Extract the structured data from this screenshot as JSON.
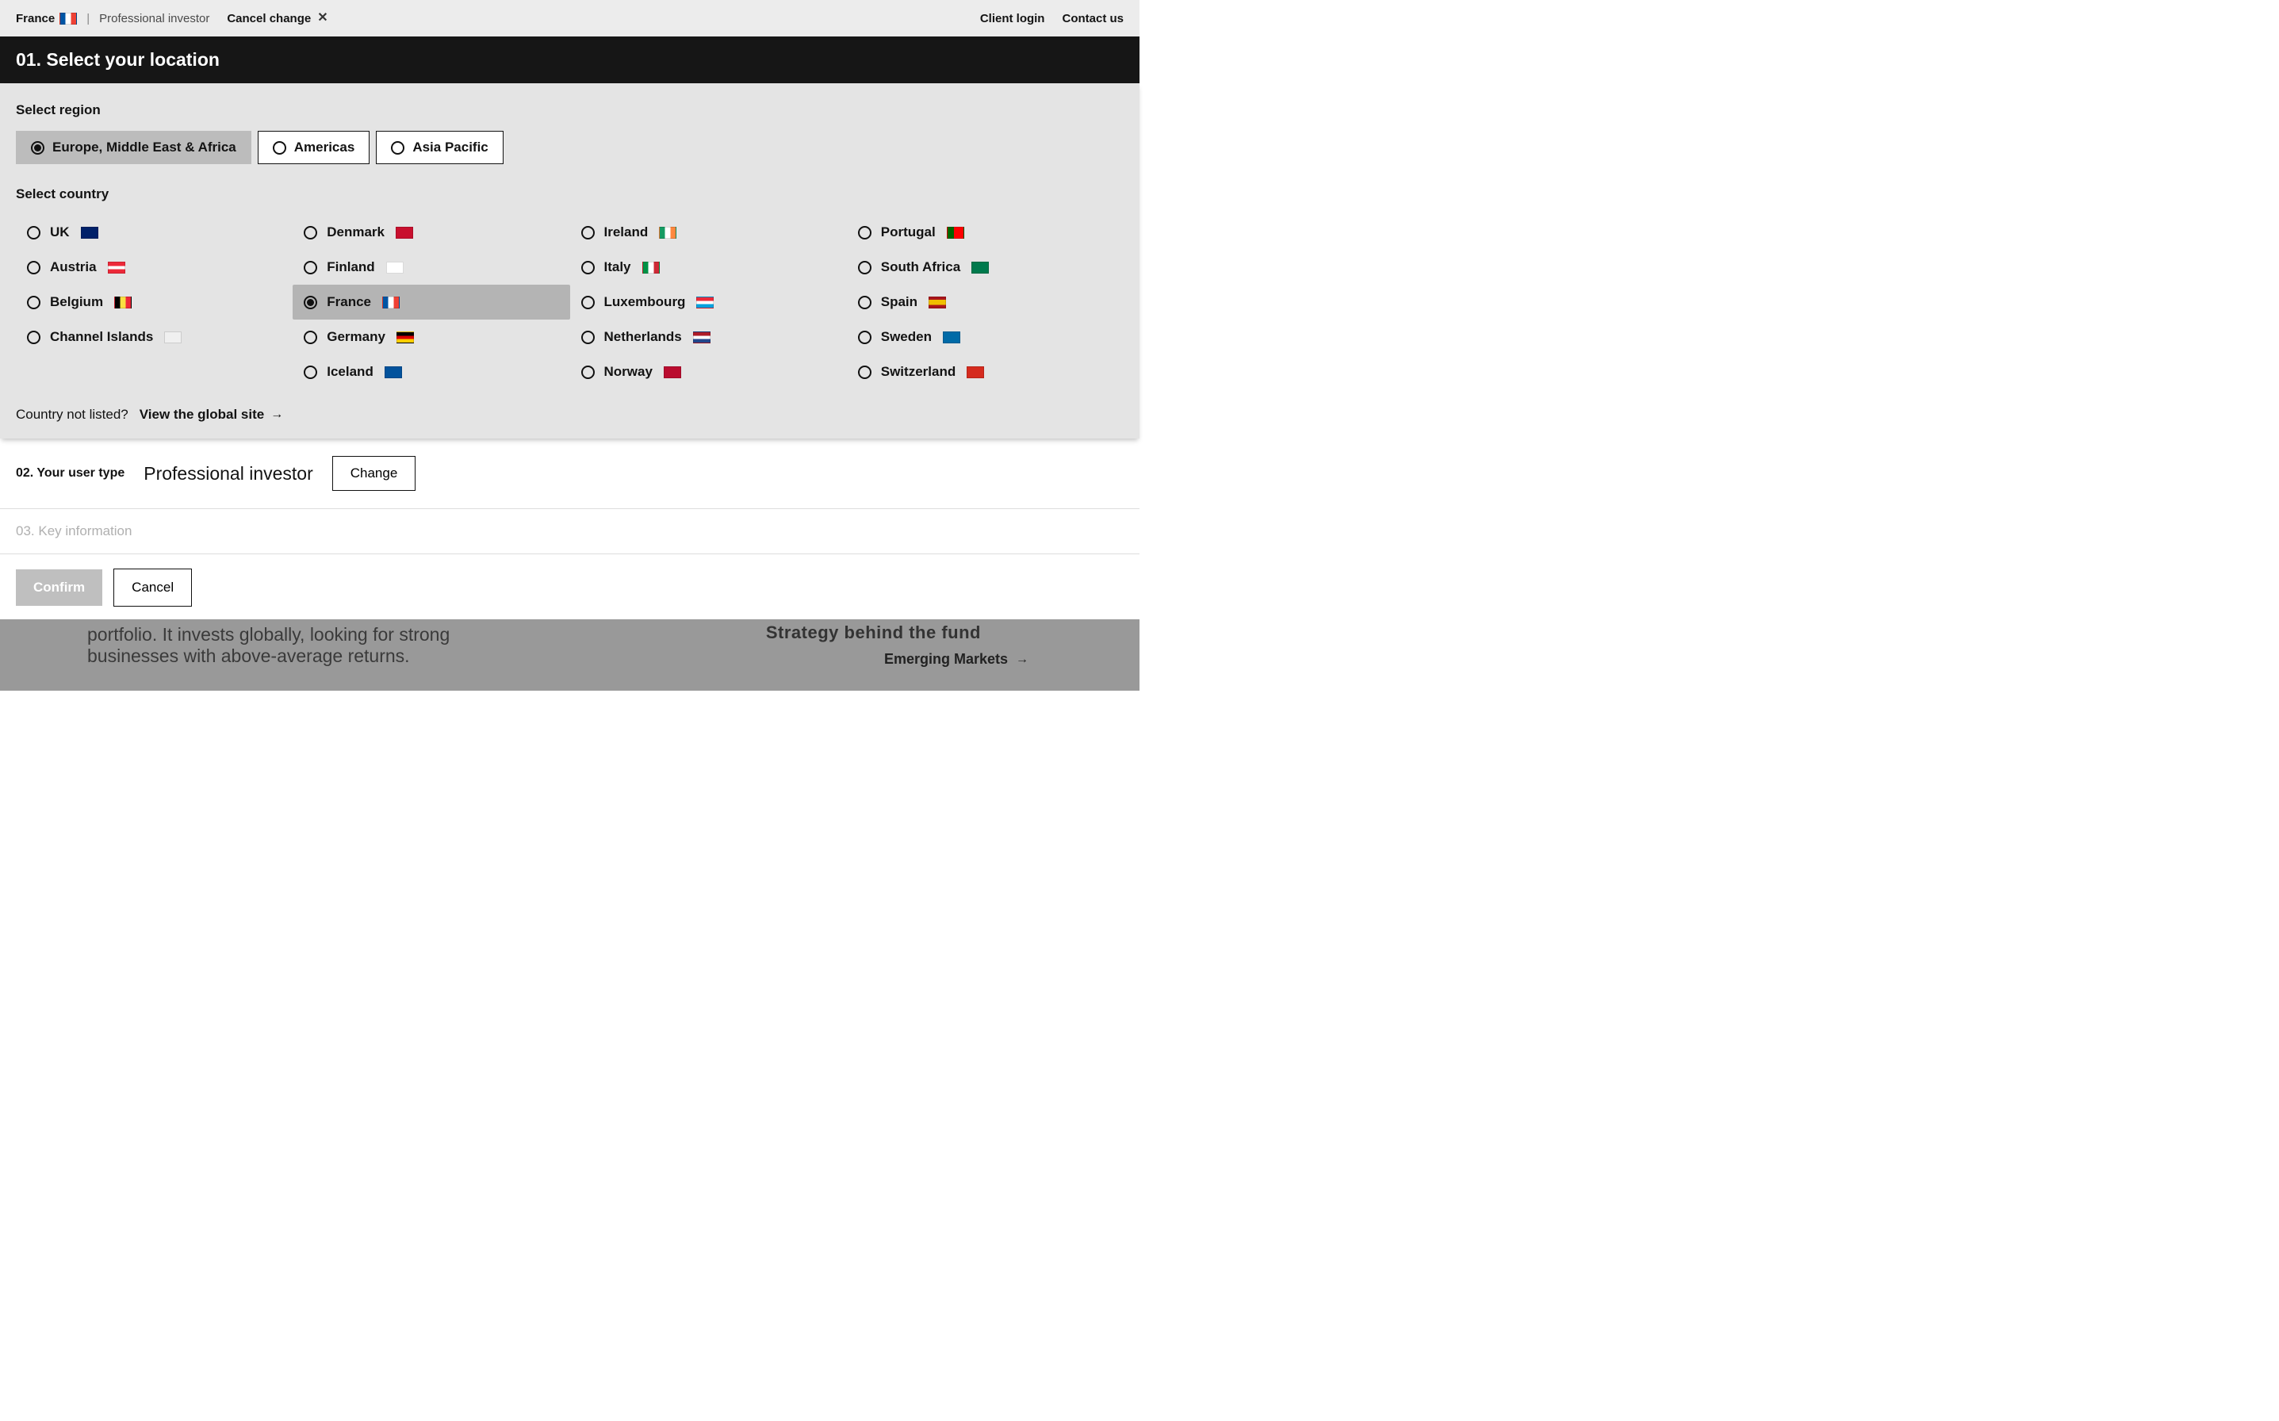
{
  "topbar": {
    "country": "France",
    "usertype": "Professional investor",
    "cancel_change": "Cancel change",
    "client_login": "Client login",
    "contact_us": "Contact us"
  },
  "step01": {
    "heading": "01. Select your location",
    "select_region_label": "Select region",
    "regions": [
      {
        "id": "emea",
        "label": "Europe, Middle East & Africa",
        "selected": true
      },
      {
        "id": "americas",
        "label": "Americas",
        "selected": false
      },
      {
        "id": "apac",
        "label": "Asia Pacific",
        "selected": false
      }
    ],
    "select_country_label": "Select country",
    "countries": [
      {
        "id": "uk",
        "label": "UK",
        "flag": "uk",
        "selected": false
      },
      {
        "id": "austria",
        "label": "Austria",
        "flag": "austria",
        "selected": false
      },
      {
        "id": "belgium",
        "label": "Belgium",
        "flag": "belgium",
        "selected": false
      },
      {
        "id": "channel-islands",
        "label": "Channel Islands",
        "flag": "channel-islands",
        "selected": false
      },
      {
        "id": "placeholder",
        "label": "",
        "flag": "",
        "selected": false,
        "placeholder": true
      },
      {
        "id": "denmark",
        "label": "Denmark",
        "flag": "denmark",
        "selected": false
      },
      {
        "id": "finland",
        "label": "Finland",
        "flag": "finland",
        "selected": false
      },
      {
        "id": "france",
        "label": "France",
        "flag": "france",
        "selected": true
      },
      {
        "id": "germany",
        "label": "Germany",
        "flag": "germany",
        "selected": false
      },
      {
        "id": "iceland",
        "label": "Iceland",
        "flag": "iceland",
        "selected": false
      },
      {
        "id": "ireland",
        "label": "Ireland",
        "flag": "ireland",
        "selected": false
      },
      {
        "id": "italy",
        "label": "Italy",
        "flag": "italy",
        "selected": false
      },
      {
        "id": "luxembourg",
        "label": "Luxembourg",
        "flag": "luxembourg",
        "selected": false
      },
      {
        "id": "netherlands",
        "label": "Netherlands",
        "flag": "netherlands",
        "selected": false
      },
      {
        "id": "norway",
        "label": "Norway",
        "flag": "norway",
        "selected": false
      },
      {
        "id": "portugal",
        "label": "Portugal",
        "flag": "portugal",
        "selected": false
      },
      {
        "id": "south-africa",
        "label": "South Africa",
        "flag": "south-africa",
        "selected": false
      },
      {
        "id": "spain",
        "label": "Spain",
        "flag": "spain",
        "selected": false
      },
      {
        "id": "sweden",
        "label": "Sweden",
        "flag": "sweden",
        "selected": false
      },
      {
        "id": "switzerland",
        "label": "Switzerland",
        "flag": "switzerland",
        "selected": false
      }
    ],
    "not_listed_label": "Country not listed?",
    "global_site_label": "View the global site"
  },
  "step02": {
    "label": "02. Your user type",
    "value": "Professional investor",
    "change_label": "Change"
  },
  "step03": {
    "label": "03. Key information"
  },
  "actions": {
    "confirm_label": "Confirm",
    "cancel_label": "Cancel"
  },
  "background": {
    "line1": "portfolio. It invests globally, looking for strong",
    "line2": "businesses with above-average returns.",
    "right_top": "Strategy behind the fund",
    "right_link": "Emerging Markets"
  },
  "flags": {
    "france": "linear-gradient(90deg,#0055A4 33.3%,#fff 33.3%,#fff 66.6%,#EF4135 66.6%)",
    "uk": "linear-gradient(#012169,#012169)",
    "austria": "linear-gradient(#ED2939 33.3%,#fff 33.3%,#fff 66.6%,#ED2939 66.6%)",
    "belgium": "linear-gradient(90deg,#000 33.3%,#FAE042 33.3%,#FAE042 66.6%,#ED2939 66.6%)",
    "channel-islands": "linear-gradient(#f0f0f0,#f0f0f0)",
    "denmark": "linear-gradient(#C8102E,#C8102E)",
    "finland": "linear-gradient(#fff,#fff)",
    "germany": "linear-gradient(#000 33.3%,#DD0000 33.3%,#DD0000 66.6%,#FFCE00 66.6%)",
    "iceland": "linear-gradient(#02529C,#02529C)",
    "ireland": "linear-gradient(90deg,#169B62 33.3%,#fff 33.3%,#fff 66.6%,#FF883E 66.6%)",
    "italy": "linear-gradient(90deg,#009246 33.3%,#fff 33.3%,#fff 66.6%,#CE2B37 66.6%)",
    "luxembourg": "linear-gradient(#ED2939 33.3%,#fff 33.3%,#fff 66.6%,#00A1DE 66.6%)",
    "netherlands": "linear-gradient(#AE1C28 33.3%,#fff 33.3%,#fff 66.6%,#21468B 66.6%)",
    "norway": "linear-gradient(#BA0C2F,#BA0C2F)",
    "portugal": "linear-gradient(90deg,#006600 40%,#FF0000 40%)",
    "south-africa": "linear-gradient(#007A4D 50%,#007A4D 50%)",
    "spain": "linear-gradient(#AA151B 25%,#F1BF00 25%,#F1BF00 75%,#AA151B 75%)",
    "sweden": "linear-gradient(#006AA7,#006AA7)",
    "switzerland": "linear-gradient(#D52B1E,#D52B1E)"
  }
}
